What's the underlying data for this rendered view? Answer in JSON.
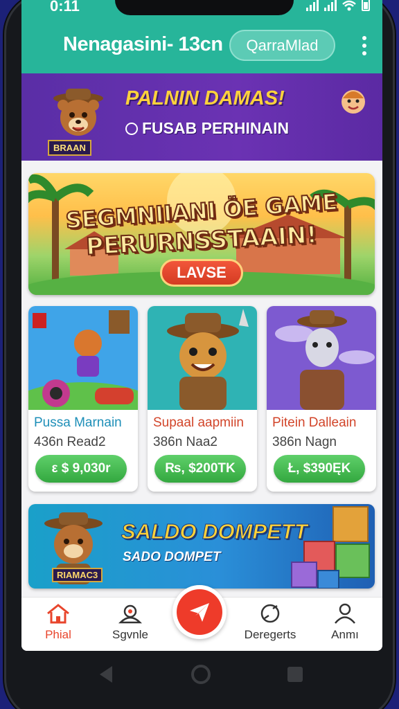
{
  "status": {
    "time": "0:11"
  },
  "appbar": {
    "title": "Nenagasini- 13cn",
    "button_label": "QarraMlad"
  },
  "promo": {
    "title": "PALNIN DAMAS!",
    "subtitle": "FUSAB PERHINAIN",
    "badge": "BRAAN"
  },
  "hero": {
    "title_line1": "SEGMNIIANI ÖE GAME",
    "title_line2": "PERURNSSTAAIN!",
    "button_label": "LAVSE"
  },
  "cards": [
    {
      "name": "Pussa Marnain",
      "sub": "436n Read2",
      "price": "ε $ 9,030r",
      "name_color": "#1e8fb8"
    },
    {
      "name": "Supaal aapmiin",
      "sub": "386n Naa2",
      "price": "₨, $200TK",
      "name_color": "#d2452a"
    },
    {
      "name": "Pitein Dalleain",
      "sub": "386n Nagn",
      "price": "Ł, $390ĘK",
      "name_color": "#d2452a"
    }
  ],
  "saldo": {
    "title": "SALDO DOMPETT",
    "subtitle": "SADO DOMPET",
    "badge": "RIAMAC3"
  },
  "nav": [
    {
      "label": "Phial",
      "icon": "home-icon",
      "active": true
    },
    {
      "label": "Sgvnle",
      "icon": "games-icon",
      "active": false
    },
    {
      "label": "Deregerts",
      "icon": "deposit-icon",
      "active": false
    },
    {
      "label": "Anmı",
      "icon": "profile-icon",
      "active": false
    }
  ],
  "colors": {
    "appbar": "#27b59a",
    "accent": "#ee3b2a",
    "price_green": "#3cb04a",
    "promo_purple": "#5a2ea6"
  }
}
